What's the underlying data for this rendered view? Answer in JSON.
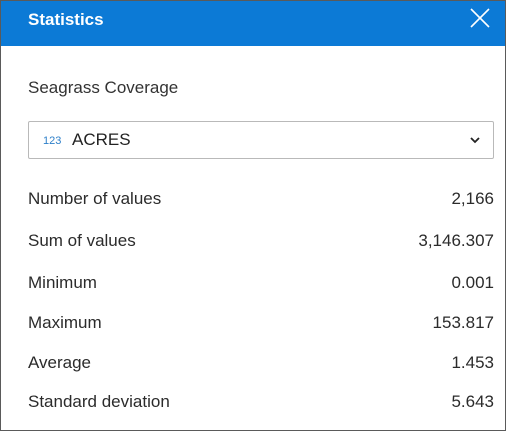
{
  "header": {
    "title": "Statistics",
    "close_icon": "close-icon"
  },
  "layer": {
    "name": "Seagrass Coverage"
  },
  "field_select": {
    "type_icon_text": "123",
    "selected_value": "ACRES",
    "chevron_icon": "chevron-down-icon"
  },
  "stats": [
    {
      "label": "Number of values",
      "value": "2,166"
    },
    {
      "label": "Sum of values",
      "value": "3,146.307"
    },
    {
      "label": "Minimum",
      "value": "0.001"
    },
    {
      "label": "Maximum",
      "value": "153.817"
    },
    {
      "label": "Average",
      "value": "1.453"
    },
    {
      "label": "Standard deviation",
      "value": "5.643"
    }
  ],
  "colors": {
    "header_bg": "#0c7ad6",
    "accent": "#2d7fc9"
  }
}
